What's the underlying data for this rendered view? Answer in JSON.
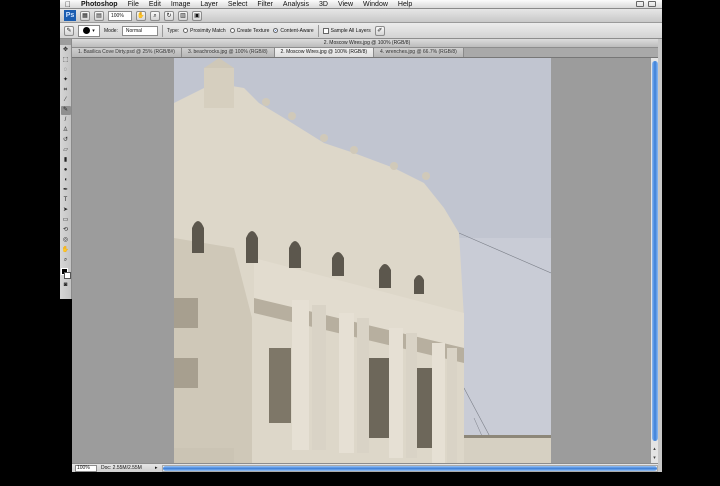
{
  "menubar": {
    "apple_icon": "apple-icon",
    "app_name": "Photoshop",
    "items": [
      "File",
      "Edit",
      "Image",
      "Layer",
      "Select",
      "Filter",
      "Analysis",
      "3D",
      "View",
      "Window",
      "Help"
    ]
  },
  "appbar": {
    "logo": "Ps",
    "zoom": "100%"
  },
  "options": {
    "mode_label": "Mode:",
    "mode_value": "Normal",
    "type_label": "Type:",
    "radio_proximity": "Proximity Match",
    "radio_texture": "Create Texture",
    "radio_content": "Content-Aware",
    "sample_all": "Sample All Layers"
  },
  "document": {
    "title": "2. Moscow Wires.jpg @ 100% (RGB/8)",
    "tabs": [
      "1. Basilica Cove Dirty.psd @ 25% (RGB/8#)",
      "3. beachrocks.jpg @ 100% (RGB/8)",
      "2. Moscow Wires.jpg @ 100% (RGB/8)",
      "4. wrenches.jpg @ 66.7% (RGB/8)"
    ],
    "active_tab": 2
  },
  "status": {
    "zoom": "100%",
    "doc_info": "Doc: 2.55M/2.55M"
  },
  "colors": {
    "sky": "#c9ccd6",
    "building": "#ddd7c9",
    "shadow": "#a79f8f",
    "scroll_accent": "#3a7ed8"
  }
}
